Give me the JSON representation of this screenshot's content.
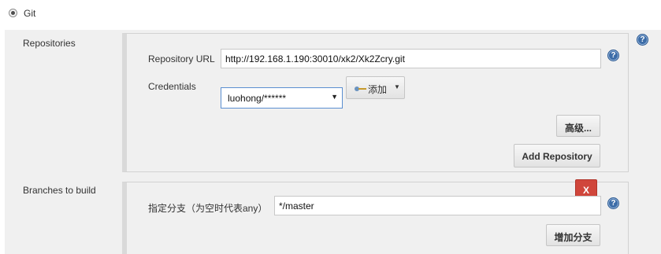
{
  "scm": {
    "option_label": "Git",
    "selected": true
  },
  "repositories": {
    "label": "Repositories",
    "url_label": "Repository URL",
    "url_value": "http://192.168.1.190:30010/xk2/Xk2Zcry.git",
    "credentials_label": "Credentials",
    "credentials_selected": "luohong/******",
    "add_credentials_label": "添加",
    "advanced_label": "高级...",
    "add_repository_label": "Add Repository"
  },
  "branches": {
    "label": "Branches to build",
    "branch_specifier_label": "指定分支（为空时代表any）",
    "branch_specifier_value": "*/master",
    "delete_label": "X",
    "add_branch_label": "增加分支"
  },
  "help_glyph": "?",
  "icons": {
    "radio": "radio-selected-icon",
    "key": "key-icon",
    "caret": "caret-down-icon",
    "help": "help-icon"
  },
  "colors": {
    "delete_button": "#d0463b",
    "help_icon": "#3d6da8",
    "focus_border": "#5b8fd1"
  }
}
